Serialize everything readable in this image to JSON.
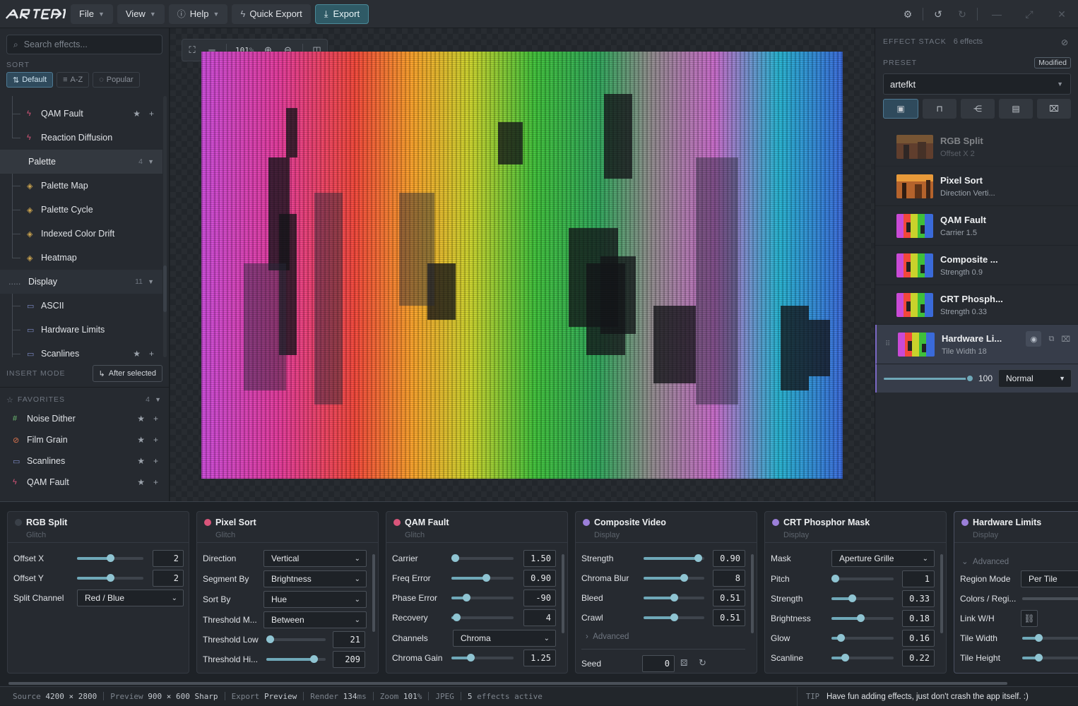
{
  "topbar": {
    "logo": "artefkt",
    "menus": [
      "File",
      "View",
      "Help"
    ],
    "quick_export": "Quick Export",
    "export": "Export"
  },
  "sidebar": {
    "search_placeholder": "Search effects...",
    "sort_label": "SORT",
    "sort_options": [
      "Default",
      "A-Z",
      "Popular"
    ],
    "tree": [
      {
        "type": "item",
        "label": "QAM Fault",
        "icon": "glitch-icon",
        "favorite": true
      },
      {
        "type": "item",
        "label": "Reaction Diffusion",
        "icon": "glitch-icon"
      },
      {
        "type": "category",
        "label": "Palette",
        "count": "4"
      },
      {
        "type": "item",
        "label": "Palette Map",
        "icon": "layers-icon"
      },
      {
        "type": "item",
        "label": "Palette Cycle",
        "icon": "layers-icon"
      },
      {
        "type": "item",
        "label": "Indexed Color Drift",
        "icon": "layers-icon"
      },
      {
        "type": "item",
        "label": "Heatmap",
        "icon": "layers-icon"
      },
      {
        "type": "category",
        "label": "Display",
        "count": "11"
      },
      {
        "type": "item",
        "label": "ASCII",
        "icon": "display-icon"
      },
      {
        "type": "item",
        "label": "Hardware Limits",
        "icon": "display-icon"
      },
      {
        "type": "item",
        "label": "Scanlines",
        "icon": "display-icon",
        "favorite": true
      }
    ],
    "insert_mode_label": "INSERT MODE",
    "insert_mode_value": "After selected",
    "favorites_label": "FAVORITES",
    "favorites_count": "4",
    "favorites": [
      {
        "label": "Noise Dither",
        "icon": "hash-icon",
        "color": "#6fbf73"
      },
      {
        "label": "Film Grain",
        "icon": "film-icon",
        "color": "#d9734e"
      },
      {
        "label": "Scanlines",
        "icon": "display-icon",
        "color": "#7f8cc9"
      },
      {
        "label": "QAM Fault",
        "icon": "glitch-icon",
        "color": "#d9557a"
      }
    ]
  },
  "canvas": {
    "zoom": "101",
    "zoom_unit": "%"
  },
  "effect_stack": {
    "title": "EFFECT STACK",
    "count": "6 effects",
    "preset_label": "PRESET",
    "modified": "Modified",
    "preset_value": "artefkt",
    "items": [
      {
        "name": "RGB Split",
        "sub": "Offset X 2",
        "dim": true
      },
      {
        "name": "Pixel Sort",
        "sub": "Direction Verti..."
      },
      {
        "name": "QAM Fault",
        "sub": "Carrier 1.5"
      },
      {
        "name": "Composite ...",
        "sub": "Strength 0.9"
      },
      {
        "name": "CRT Phosph...",
        "sub": "Strength 0.33"
      },
      {
        "name": "Hardware Li...",
        "sub": "Tile Width 18",
        "selected": true
      }
    ],
    "opacity": "100",
    "opacity_fraction": 1.0,
    "blend_mode": "Normal"
  },
  "cards": {
    "rgb_split": {
      "title": "RGB Split",
      "category": "Glitch",
      "dot": "#3a4048",
      "offset_x_label": "Offset X",
      "offset_x": "2",
      "offset_y_label": "Offset Y",
      "offset_y": "2",
      "split_channel_label": "Split Channel",
      "split_channel": "Red / Blue"
    },
    "pixel_sort": {
      "title": "Pixel Sort",
      "category": "Glitch",
      "dot": "#d9557a",
      "direction_label": "Direction",
      "direction": "Vertical",
      "segment_by_label": "Segment By",
      "segment_by": "Brightness",
      "sort_by_label": "Sort By",
      "sort_by": "Hue",
      "threshold_mode_label": "Threshold M...",
      "threshold_mode": "Between",
      "threshold_low_label": "Threshold Low",
      "threshold_low": "21",
      "threshold_high_label": "Threshold Hi...",
      "threshold_high": "209"
    },
    "qam_fault": {
      "title": "QAM Fault",
      "category": "Glitch",
      "dot": "#d9557a",
      "carrier_label": "Carrier",
      "carrier": "1.50",
      "freq_error_label": "Freq Error",
      "freq_error": "0.90",
      "phase_error_label": "Phase Error",
      "phase_error": "-90",
      "recovery_label": "Recovery",
      "recovery": "4",
      "channels_label": "Channels",
      "channels": "Chroma",
      "chroma_gain_label": "Chroma Gain",
      "chroma_gain": "1.25"
    },
    "composite": {
      "title": "Composite Video",
      "category": "Display",
      "dot": "#9b7fd9",
      "strength_label": "Strength",
      "strength": "0.90",
      "chroma_blur_label": "Chroma Blur",
      "chroma_blur": "8",
      "bleed_label": "Bleed",
      "bleed": "0.51",
      "crawl_label": "Crawl",
      "crawl": "0.51",
      "advanced": "Advanced",
      "seed_label": "Seed",
      "seed": "0"
    },
    "crt": {
      "title": "CRT Phosphor Mask",
      "category": "Display",
      "dot": "#9b7fd9",
      "mask_label": "Mask",
      "mask": "Aperture Grille",
      "pitch_label": "Pitch",
      "pitch": "1",
      "strength_label": "Strength",
      "strength": "0.33",
      "brightness_label": "Brightness",
      "brightness": "0.18",
      "glow_label": "Glow",
      "glow": "0.16",
      "scanline_label": "Scanline",
      "scanline": "0.22"
    },
    "hardware": {
      "title": "Hardware Limits",
      "category": "Display",
      "dot": "#9b7fd9",
      "advanced": "Advanced",
      "region_mode_label": "Region Mode",
      "region_mode": "Per Tile",
      "colors_label": "Colors / Regi...",
      "link_label": "Link W/H",
      "tile_width_label": "Tile Width",
      "tile_height_label": "Tile Height"
    }
  },
  "status": {
    "source_label": "Source",
    "source": "4200 × 2800",
    "preview_label": "Preview",
    "preview": "900 × 600 Sharp",
    "export_label": "Export",
    "export": "Preview",
    "render_label": "Render",
    "render": "134",
    "render_unit": "ms",
    "zoom_label": "Zoom",
    "zoom": "101",
    "zoom_unit": "%",
    "format": "JPEG",
    "effects_active": "5",
    "effects_active_label": "effects active",
    "tip_label": "TIP",
    "tip": "Have fun adding effects, just don't crash the app itself. :)"
  },
  "colors": {
    "accent": "#6fa8b8",
    "selected_stack": "#7c6ac7",
    "export_button": "#2f5a66"
  }
}
